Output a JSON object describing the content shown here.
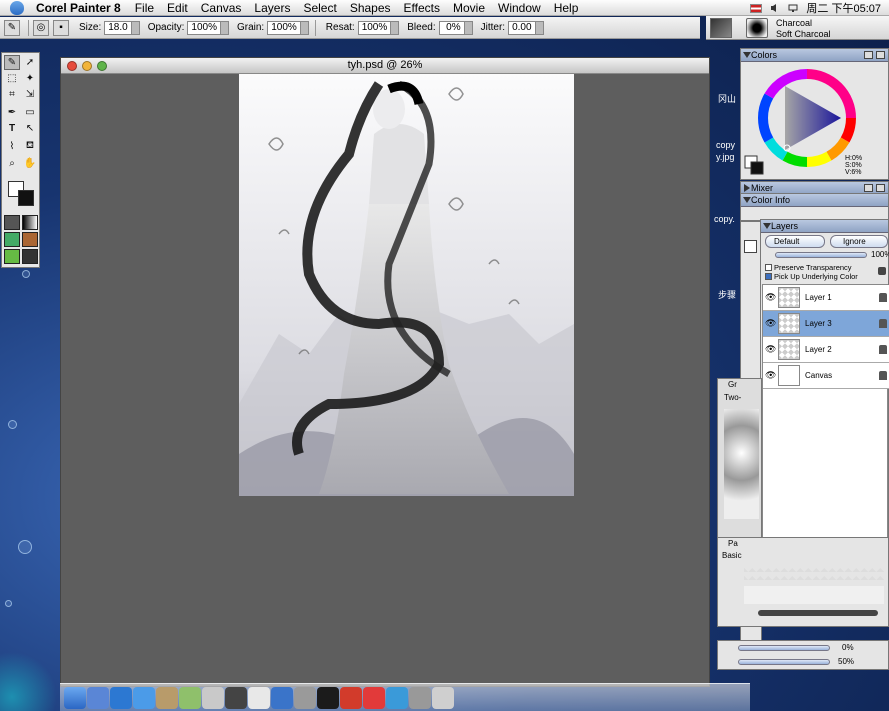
{
  "menubar": {
    "app_name": "Corel Painter 8",
    "items": [
      "File",
      "Edit",
      "Canvas",
      "Layers",
      "Select",
      "Shapes",
      "Effects",
      "Movie",
      "Window",
      "Help"
    ],
    "clock": "周二 下午05:07"
  },
  "propbar": {
    "size_label": "Size:",
    "size_value": "18.0",
    "opacity_label": "Opacity:",
    "opacity_value": "100%",
    "grain_label": "Grain:",
    "grain_value": "100%",
    "resat_label": "Resat:",
    "resat_value": "100%",
    "bleed_label": "Bleed:",
    "bleed_value": "0%",
    "jitter_label": "Jitter:",
    "jitter_value": "0.00"
  },
  "brush": {
    "category": "Charcoal",
    "variant": "Soft Charcoal"
  },
  "document": {
    "title": "tyh.psd @ 26%"
  },
  "colors_panel": {
    "title": "Colors",
    "h": "H:0%",
    "s": "S:0%",
    "v": "V:6%"
  },
  "mixer_panel": {
    "title": "Mixer"
  },
  "colorinfo_panel": {
    "title": "Color Info"
  },
  "layers_panel": {
    "title": "Layers",
    "composite_method": "Default",
    "depth": "Ignore",
    "opacity": "100%",
    "preserve_transparency": "Preserve Transparency",
    "pick_up_color": "Pick Up Underlying Color",
    "layers": [
      {
        "name": "Layer 1",
        "selected": false
      },
      {
        "name": "Layer 3",
        "selected": true
      },
      {
        "name": "Layer 2",
        "selected": false
      },
      {
        "name": "Canvas",
        "selected": false
      }
    ]
  },
  "side_panel": {
    "paper_title": "Pa",
    "paper_item": "Basic",
    "gr_title": "Gr",
    "gr_item": "Two-"
  },
  "bottom_sliders": {
    "value1": "0%",
    "value2": "50%"
  },
  "desktop_labels": {
    "label1": "冈山",
    "label2": "copy",
    "label3": "y.jpg",
    "label4": "copy.",
    "label5": "步骤"
  },
  "colors": {
    "canvas_bg": "#5e5e5e",
    "selection_blue": "#7ea6d9",
    "desktop_blue": "#1b3a78"
  }
}
